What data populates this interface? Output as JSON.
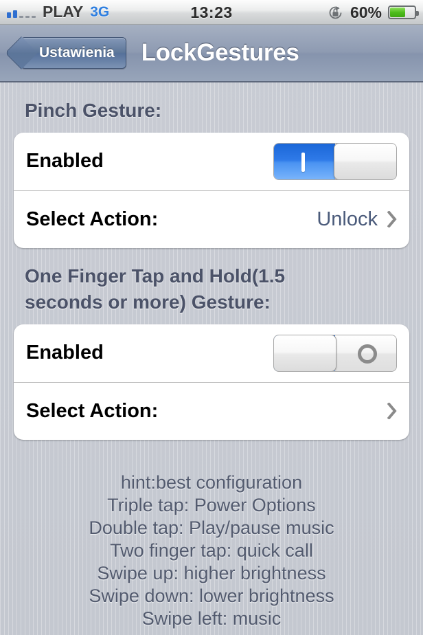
{
  "statusbar": {
    "carrier": "PLAY",
    "network": "3G",
    "time": "13:23",
    "battery_percent": "60%",
    "battery_level": 60,
    "signal_bars_filled": 2,
    "signal_bars_total": 5,
    "rotation_lock_icon": "rotation-lock-icon"
  },
  "navbar": {
    "back_label": "Ustawienia",
    "title": "LockGestures"
  },
  "sections": [
    {
      "header": "Pinch Gesture:",
      "rows": [
        {
          "label": "Enabled",
          "type": "switch",
          "state": "on"
        },
        {
          "label": "Select Action:",
          "type": "disclosure",
          "value": "Unlock"
        }
      ]
    },
    {
      "header": "One Finger Tap and Hold(1.5 seconds or more) Gesture:",
      "rows": [
        {
          "label": "Enabled",
          "type": "switch",
          "state": "off"
        },
        {
          "label": "Select Action:",
          "type": "disclosure",
          "value": ""
        }
      ]
    }
  ],
  "hint_lines": [
    "hint:best configuration",
    "Triple tap: Power Options",
    "Double tap: Play/pause music",
    "Two finger tap: quick call",
    "Swipe up: higher brightness",
    "Swipe down: lower brightness",
    "Swipe left: music"
  ],
  "colors": {
    "accent_blue": "#2f7ae8",
    "link_blue": "#4a5a7a",
    "header_text": "#4b5268",
    "navbar_blue": "#8e9bb2",
    "battery_green": "#4cbb1b"
  }
}
